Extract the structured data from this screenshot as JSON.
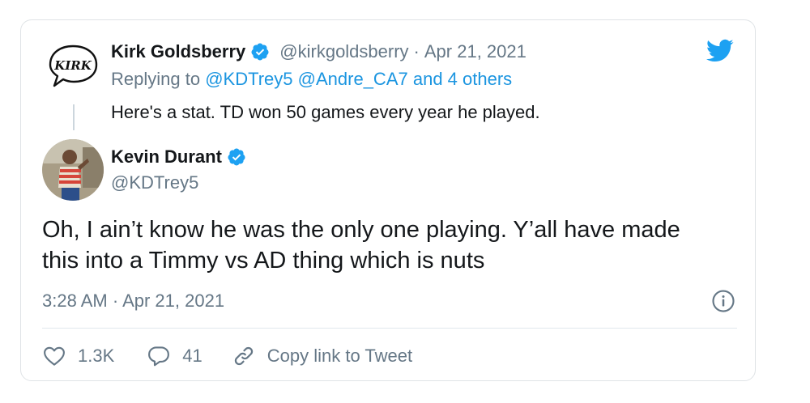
{
  "parent_tweet": {
    "avatar_text": "KIRK",
    "display_name": "Kirk Goldsberry",
    "handle": "@kirkgoldsberry",
    "separator": "·",
    "date": "Apr 21, 2021",
    "replying_prefix": "Replying to",
    "replying_users": [
      "@KDTrey5",
      "@Andre_CA7"
    ],
    "replying_others": "and 4 others",
    "text": "Here's a stat. TD won 50 games every year he played."
  },
  "tweet": {
    "display_name": "Kevin Durant",
    "handle": "@KDTrey5",
    "text_line1": "Oh, I ain’t know he was the only one playing. Y’all have made",
    "text_line2": "this into a Timmy vs AD thing which is nuts",
    "time": "3:28 AM",
    "separator": "·",
    "date": "Apr 21, 2021"
  },
  "actions": {
    "like_count": "1.3K",
    "reply_count": "41",
    "copy_link_label": "Copy link to Tweet"
  },
  "icons": {
    "logo": "twitter-bird-icon",
    "verified": "verified-badge-icon",
    "info": "info-icon",
    "like": "heart-icon",
    "reply": "speech-bubble-icon",
    "copy": "link-icon"
  },
  "colors": {
    "accent": "#1b95e0",
    "logo": "#1da1f2",
    "muted": "#657786",
    "text": "#14171a",
    "border": "#dfe3e6"
  }
}
